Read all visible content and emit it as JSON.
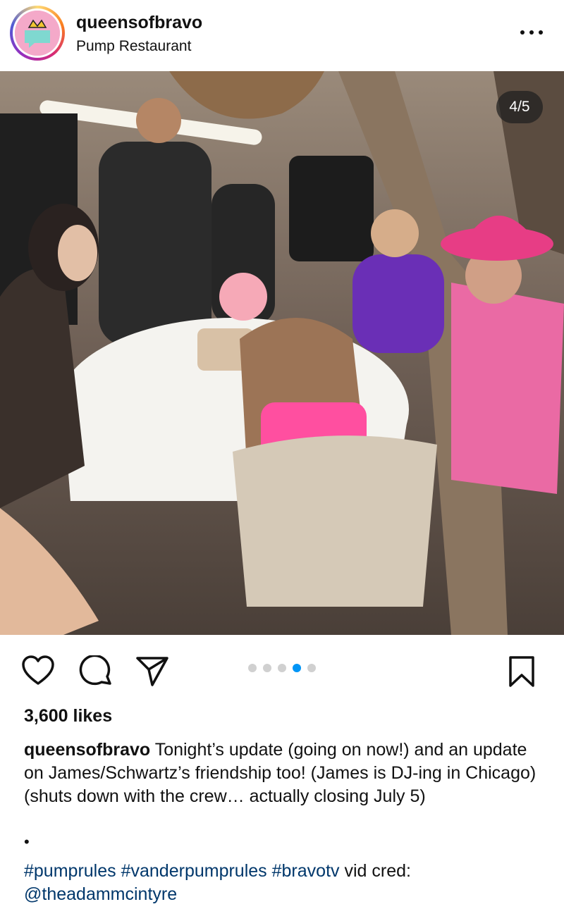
{
  "post": {
    "username": "queensofbravo",
    "location": "Pump Restaurant",
    "image_counter": "4/5",
    "likes": "3,600 likes",
    "carousel": {
      "total": 5,
      "active": 4
    },
    "caption": {
      "username": "queensofbravo",
      "text": " Tonight’s update (going on now!) and an update on James/Schwartz’s friendship too! (James is DJ-ing in Chicago) (shuts down with the crew… actually closing July 5)",
      "bullet": "•",
      "hashtags": [
        "#pumprules",
        "#vanderpumprules",
        "#bravotv"
      ],
      "trailing": " vid cred:",
      "mention": "@theadammcintyre"
    }
  },
  "icons": {
    "more": "more-icon",
    "like": "heart-icon",
    "comment": "comment-icon",
    "share": "send-icon",
    "save": "bookmark-icon"
  },
  "colors": {
    "accent": "#0095f6",
    "link": "#00376b",
    "dot_inactive": "#d0d0d0"
  }
}
